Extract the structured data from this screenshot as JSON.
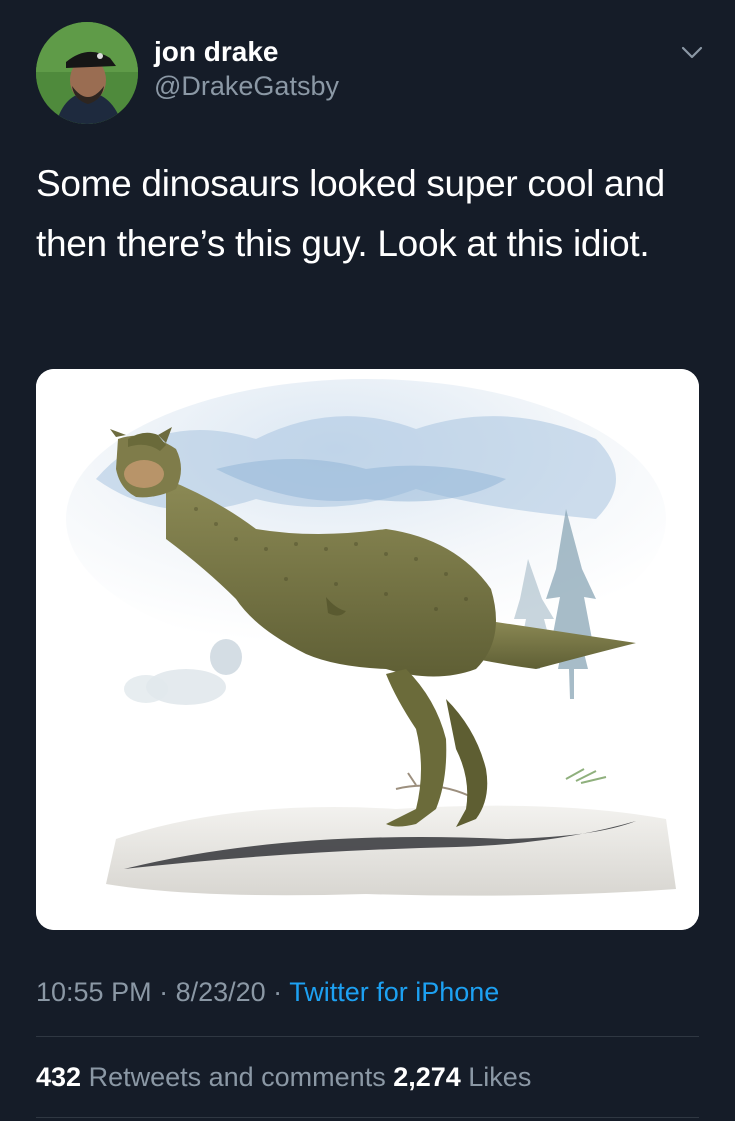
{
  "author": {
    "display_name": "jon drake",
    "handle": "@DrakeGatsby",
    "avatar_icon": "user-avatar"
  },
  "tweet": {
    "text": "Some dinosaurs looked super cool and then there’s this guy. Look at this idiot.",
    "media_description_icon": "dinosaur-illustration"
  },
  "meta": {
    "time": "10:55 PM",
    "sep1": " · ",
    "date": "8/23/20",
    "sep2": " · ",
    "source": "Twitter for iPhone"
  },
  "stats": {
    "retweets_count": "432",
    "retweets_label": " Retweets and comments ",
    "likes_count": "2,274",
    "likes_label": " Likes"
  },
  "colors": {
    "background": "#151c28",
    "link": "#1da1f2",
    "secondary_text": "#8b98a5"
  }
}
